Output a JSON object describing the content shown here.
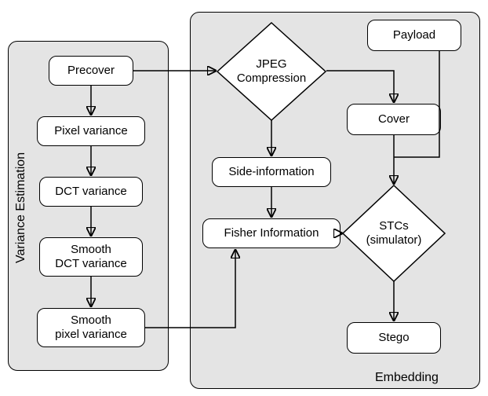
{
  "panels": {
    "variance_estimation": {
      "label": "Variance Estimation"
    },
    "embedding": {
      "label": "Embedding"
    }
  },
  "nodes": {
    "precover": "Precover",
    "pixel_variance": "Pixel variance",
    "dct_variance": "DCT variance",
    "smooth_dct_variance": "Smooth\nDCT variance",
    "smooth_pixel_variance": "Smooth\npixel variance",
    "jpeg_compression": "JPEG\nCompression",
    "payload": "Payload",
    "cover": "Cover",
    "side_information": "Side-information",
    "fisher_information": "Fisher Information",
    "stcs": "STCs\n(simulator)",
    "stego": "Stego"
  }
}
